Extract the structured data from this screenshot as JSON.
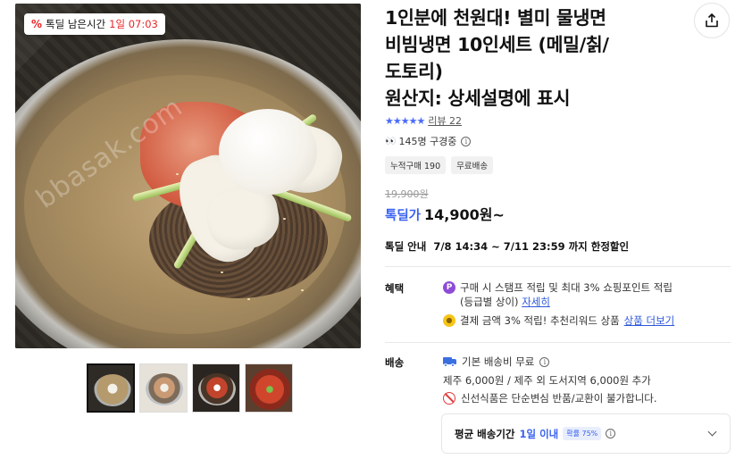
{
  "deal_badge": {
    "label": "톡딜 남은시간",
    "time": "1일 07:03"
  },
  "main_image": {
    "watermark": "bbasak.com"
  },
  "thumbnails": [
    {
      "name": "thumb-1",
      "active": true
    },
    {
      "name": "thumb-2",
      "active": false
    },
    {
      "name": "thumb-3",
      "active": false
    },
    {
      "name": "thumb-4",
      "active": false
    }
  ],
  "product": {
    "title_line1": "1인분에 천원대! 별미 물냉면",
    "title_line2": "비빔냉면 10인세트 (메밀/칡/",
    "title_line3": "도토리)",
    "title_line4": "원산지: 상세설명에 표시"
  },
  "rating": {
    "stars": 5,
    "review_label": "리뷰 22"
  },
  "viewers": {
    "text": "145명 구경중"
  },
  "tags": [
    "누적구매 190",
    "무료배송"
  ],
  "price": {
    "original": "19,900원",
    "label": "톡딜가",
    "value": "14,900원~"
  },
  "deal_info": {
    "label": "톡딜 안내",
    "value": "7/8 14:34 ~ 7/11 23:59 까지 한정할인"
  },
  "benefits": {
    "label": "혜택",
    "line1": "구매 시 스탬프 적립 및 최대 3% 쇼핑포인트 적립",
    "line1b": "(등급별 상이)",
    "line1_link": "자세히",
    "line2": "결제 금액 3% 적립! 추천리워드 상품",
    "line2_link": "상품 더보기"
  },
  "shipping": {
    "label": "배송",
    "basic": "기본 배송비 무료",
    "extra": "제주 6,000원 / 제주 외 도서지역 6,000원 추가",
    "notice": "신선식품은 단순변심 반품/교환이 불가합니다.",
    "avg_label": "평균 배송기간",
    "avg_value": "1일 이내",
    "avg_prob": "확률 75%"
  },
  "colors": {
    "accent": "#3a62f0",
    "deal_red": "#e8262a",
    "point_purple": "#8e4bd6",
    "coin_yellow": "#f5c518"
  }
}
